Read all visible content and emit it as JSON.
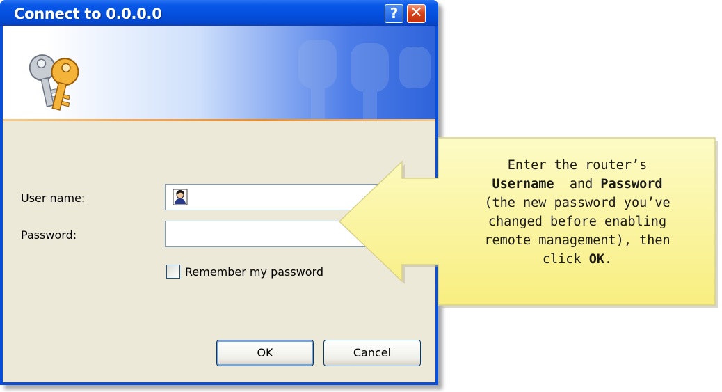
{
  "dialog": {
    "title": "Connect to 0.0.0.0",
    "help_button": "?",
    "close_button": "✕",
    "username_label": "User name:",
    "password_label": "Password:",
    "remember_label": "Remember my password",
    "remember_checked": false,
    "username_value": "",
    "password_value": "",
    "ok_label": "OK",
    "cancel_label": "Cancel"
  },
  "callout": {
    "line1": "Enter the router’s",
    "username_word": "Username",
    "and_word": "and",
    "password_word": "Password",
    "line3": "(the new password you’ve",
    "line4": "changed before enabling",
    "line5": "remote management), then",
    "line6_pre": "click",
    "ok_word": "OK",
    "line6_post": "."
  },
  "colors": {
    "titlebar": "#0551e0",
    "dialog_bg": "#ece9d8",
    "callout_bg": "#fdf8a8",
    "accent_strip": "#ef8a24"
  },
  "icons": {
    "banner": "keys-icon",
    "username_field": "user-avatar-icon"
  }
}
